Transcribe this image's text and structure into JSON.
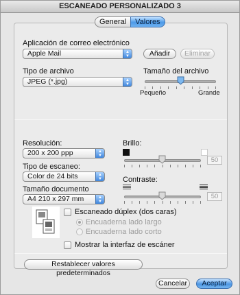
{
  "window": {
    "title": "ESCANEADO PERSONALIZADO 3"
  },
  "tabs": [
    {
      "label": "General",
      "active": false
    },
    {
      "label": "Valores",
      "active": true
    }
  ],
  "email": {
    "label": "Aplicación de correo electrónico",
    "selected": "Apple Mail",
    "add_label": "Añadir",
    "remove_label": "Eliminar"
  },
  "file": {
    "type_label": "Tipo de archivo",
    "type_selected": "JPEG (*.jpg)",
    "size_label": "Tamaño del archivo",
    "size_min_label": "Pequeño",
    "size_max_label": "Grande",
    "size_value_fraction": 0.5
  },
  "scan": {
    "resolution_label": "Resolución:",
    "resolution_selected": "200 x 200 ppp",
    "scan_type_label": "Tipo de escaneo:",
    "scan_type_selected": "Color de 24 bits",
    "doc_size_label": "Tamaño documento",
    "doc_size_selected": "A4  210 x 297 mm",
    "brightness_label": "Brillo:",
    "brightness_value": "50",
    "contrast_label": "Contraste:",
    "contrast_value": "50",
    "duplex_label": "Escaneado dúplex (dos caras)",
    "duplex_checked": false,
    "binding_long_label": "Encuaderna lado largo",
    "binding_short_label": "Encuaderna lado corto",
    "binding_selected": "long",
    "show_interface_label": "Mostrar la interfaz de escáner",
    "show_interface_checked": false
  },
  "footer": {
    "restore_label": "Restablecer valores predeterminados",
    "cancel_label": "Cancelar",
    "accept_label": "Aceptar"
  },
  "colors": {
    "accent": "#4c9ae8",
    "panel_bg": "#ebebeb",
    "window_bg": "#e6e6e6"
  },
  "icons": {
    "popup_arrows": "up-down-arrows-icon",
    "brightness_low": "black-square-icon",
    "brightness_high": "white-square-icon",
    "contrast_low": "light-lines-icon",
    "contrast_high": "dark-lines-icon",
    "duplex_preview": "duplex-pages-icon"
  }
}
